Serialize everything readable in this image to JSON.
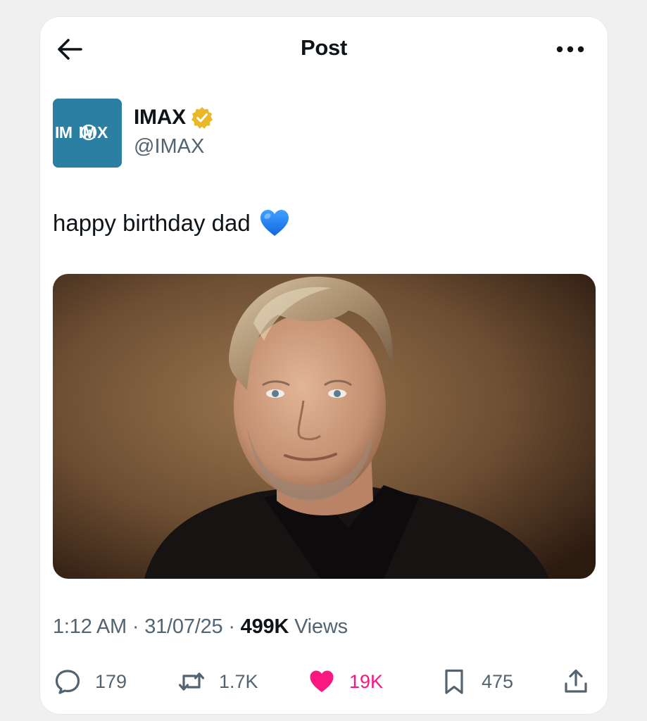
{
  "header": {
    "title": "Post"
  },
  "author": {
    "avatar_text": "IM4X",
    "name": "IMAX",
    "handle": "@IMAX",
    "verified": true
  },
  "post": {
    "text": "happy birthday dad",
    "emoji": "blue-heart"
  },
  "meta": {
    "time": "1:12 AM",
    "date": "31/07/25",
    "views_count": "499K",
    "views_label": "Views",
    "separator": "·"
  },
  "actions": {
    "replies": "179",
    "reposts": "1.7K",
    "likes": "19K",
    "bookmarks": "475"
  },
  "icons": {
    "back": "arrow-left-icon",
    "more": "more-horizontal-icon",
    "reply": "reply-icon",
    "repost": "repost-icon",
    "like": "heart-icon",
    "bookmark": "bookmark-icon",
    "share": "share-icon"
  },
  "colors": {
    "like_active": "#f91880",
    "secondary_text": "#536471",
    "verified_gold": "#e8b829",
    "avatar_bg": "#2a7fa3"
  }
}
